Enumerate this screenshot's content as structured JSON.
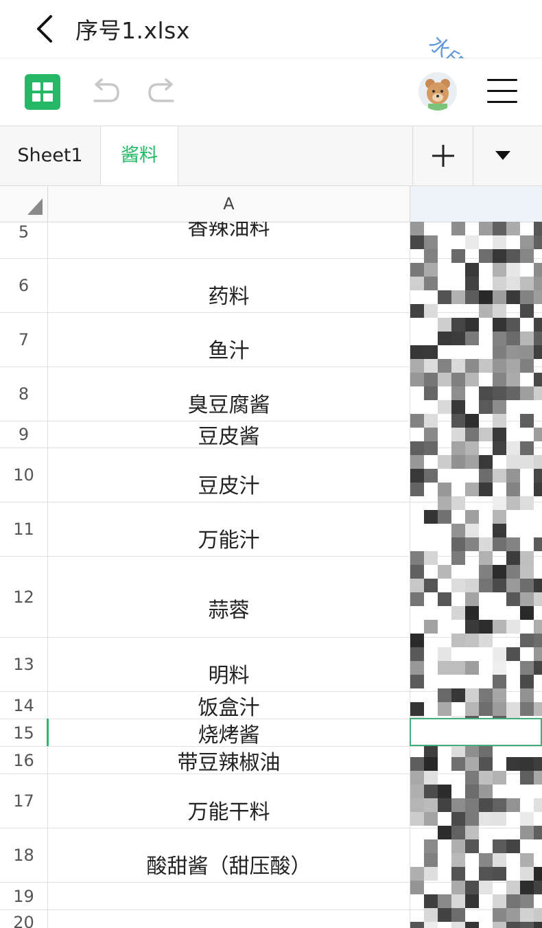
{
  "header": {
    "title": "序号1.xlsx",
    "watermark": "水印文字",
    "back_icon": "chevron-left-icon"
  },
  "toolbar": {
    "app_icon": "sheets-app-icon",
    "undo_icon": "undo-icon",
    "redo_icon": "redo-icon",
    "avatar": "bear-avatar",
    "menu_icon": "hamburger-menu-icon"
  },
  "tabs": [
    {
      "label": "Sheet1",
      "active": false
    },
    {
      "label": "酱料",
      "active": true
    }
  ],
  "tab_actions": {
    "add_icon": "plus-icon",
    "dropdown_icon": "caret-down-icon"
  },
  "columns": [
    "A"
  ],
  "rows": [
    {
      "num": "5",
      "a": "香辣油料"
    },
    {
      "num": "6",
      "a": "药料"
    },
    {
      "num": "7",
      "a": "鱼汁"
    },
    {
      "num": "8",
      "a": "臭豆腐酱"
    },
    {
      "num": "9",
      "a": "豆皮酱"
    },
    {
      "num": "10",
      "a": "豆皮汁"
    },
    {
      "num": "11",
      "a": "万能汁"
    },
    {
      "num": "12",
      "a": "蒜蓉"
    },
    {
      "num": "13",
      "a": "明料"
    },
    {
      "num": "14",
      "a": "饭盒汁"
    },
    {
      "num": "15",
      "a": "烧烤酱"
    },
    {
      "num": "16",
      "a": "带豆辣椒油"
    },
    {
      "num": "17",
      "a": "万能干料"
    },
    {
      "num": "18",
      "a": "酸甜酱（甜压酸）"
    },
    {
      "num": "19",
      "a": ""
    },
    {
      "num": "20",
      "a": ""
    }
  ],
  "selection": {
    "row": "15"
  },
  "colors": {
    "accent": "#25b866",
    "watermark": "#4f8fd6"
  }
}
